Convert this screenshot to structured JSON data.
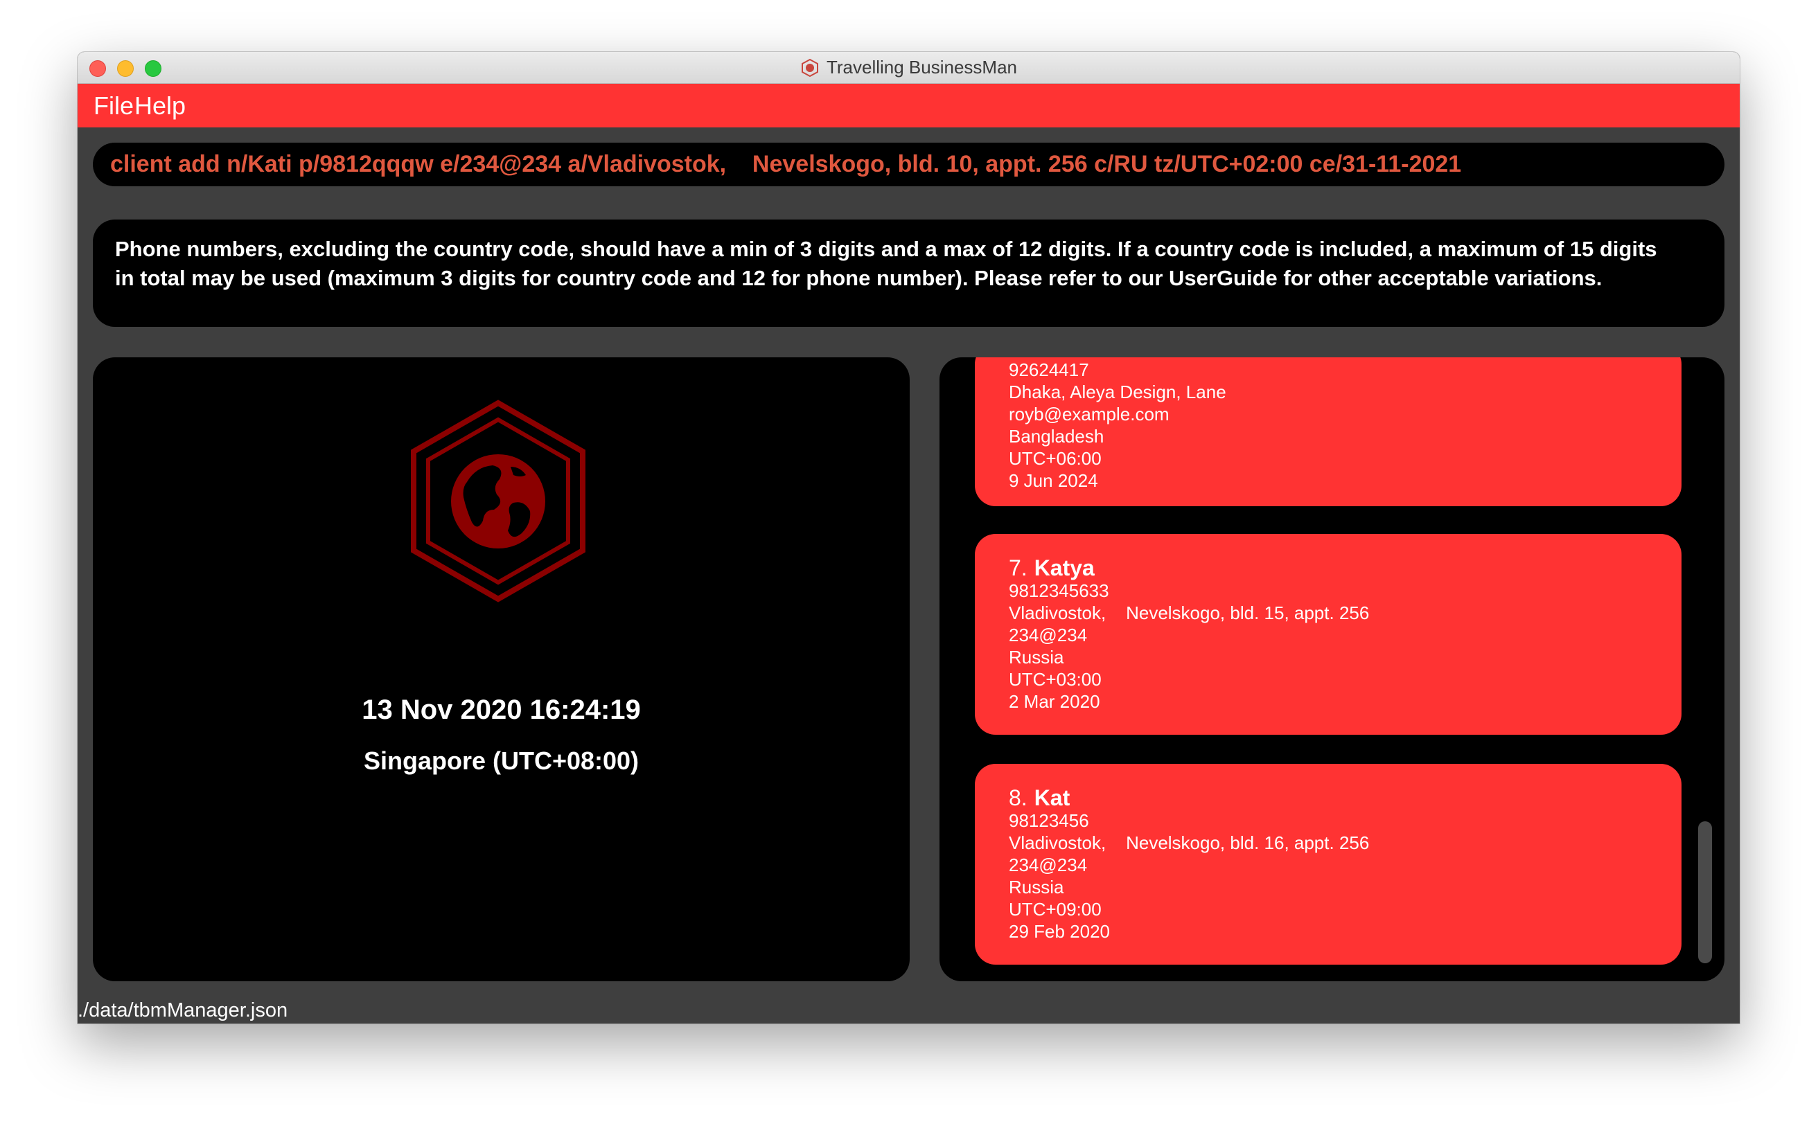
{
  "window": {
    "title": "Travelling BusinessMan"
  },
  "menu": {
    "file": "File",
    "help": "Help"
  },
  "command": {
    "text": "client add n/Kati p/9812qqqw e/234@234 a/Vladivostok,    Nevelskogo, bld. 10, appt. 256 c/RU tz/UTC+02:00 ce/31-11-2021"
  },
  "result": {
    "line1": "Phone numbers, excluding the country code, should have a min of 3 digits and a max of 12 digits. If a country code is included, a maximum of 15 digits",
    "line2": "in total may be used (maximum 3 digits for country code and 12 for phone number). Please refer to our UserGuide for other acceptable variations."
  },
  "clock": {
    "time": "13 Nov 2020 16:24:19",
    "zone": "Singapore (UTC+08:00)"
  },
  "clients": [
    {
      "phone": "92624417",
      "address": "Dhaka, Aleya Design, Lane",
      "email": "royb@example.com",
      "country": "Bangladesh",
      "timezone": "UTC+06:00",
      "contract_expiry": "9 Jun 2024"
    },
    {
      "index": "7.",
      "name": "Katya",
      "phone": "9812345633",
      "address": "Vladivostok,    Nevelskogo, bld. 15, appt. 256",
      "email": "234@234",
      "country": "Russia",
      "timezone": "UTC+03:00",
      "contract_expiry": "2 Mar 2020"
    },
    {
      "index": "8.",
      "name": "Kat",
      "phone": "98123456",
      "address": "Vladivostok,    Nevelskogo, bld. 16, appt. 256",
      "email": "234@234",
      "country": "Russia",
      "timezone": "UTC+09:00",
      "contract_expiry": "29 Feb 2020"
    }
  ],
  "status": {
    "file_path": "./data/tbmManager.json"
  },
  "colors": {
    "accent": "#ff3333",
    "panel": "#000000",
    "background": "#3f3f3f",
    "command_text": "#e0583f",
    "logo": "#8b0000"
  },
  "icons": {
    "logo": "globe-hexagon-icon"
  }
}
